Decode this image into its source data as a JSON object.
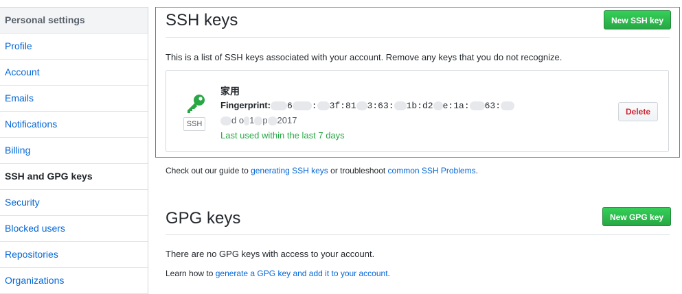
{
  "sidebar": {
    "header": "Personal settings",
    "items": [
      {
        "label": "Profile"
      },
      {
        "label": "Account"
      },
      {
        "label": "Emails"
      },
      {
        "label": "Notifications"
      },
      {
        "label": "Billing"
      },
      {
        "label": "SSH and GPG keys",
        "selected": true
      },
      {
        "label": "Security"
      },
      {
        "label": "Blocked users"
      },
      {
        "label": "Repositories"
      },
      {
        "label": "Organizations"
      }
    ]
  },
  "ssh": {
    "title": "SSH keys",
    "new_button": "New SSH key",
    "description": "This is a list of SSH keys associated with your account. Remove any keys that you do not recognize.",
    "key": {
      "name": "家用",
      "badge": "SSH",
      "fingerprint_label": "Fingerprint:",
      "fingerprint_parts": [
        "6",
        ":",
        "3f:81",
        "3:63:",
        "1b:d2",
        "e:1a:",
        "63:"
      ],
      "added_parts": [
        "d o",
        "1",
        "p",
        "2017"
      ],
      "last_used": "Last used within the last 7 days",
      "delete_button": "Delete"
    },
    "footer": {
      "prefix": "Check out our guide to ",
      "link1": "generating SSH keys",
      "middle": " or troubleshoot ",
      "link2": "common SSH Problems",
      "suffix": "."
    }
  },
  "gpg": {
    "title": "GPG keys",
    "new_button": "New GPG key",
    "empty_text": "There are no GPG keys with access to your account.",
    "learn_prefix": "Learn how to ",
    "learn_link": "generate a GPG key and add it to your account",
    "learn_suffix": "."
  },
  "colors": {
    "accent_link": "#0366d6",
    "green": "#28a745",
    "danger": "#cb2431",
    "highlight_border": "#e34d4d"
  }
}
